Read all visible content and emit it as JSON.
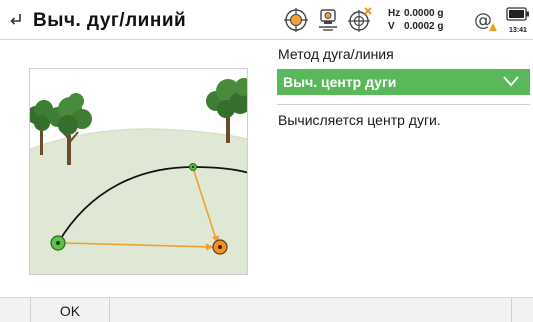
{
  "header": {
    "title": "Выч.  дуг/линий",
    "hz_label": "Hz",
    "hz_value": "0.0000 g",
    "v_label": "V",
    "v_value": "0.0002 g",
    "time": "13:41"
  },
  "form": {
    "method_label": "Метод дуга/линия",
    "method_value": "Выч. центр дуги",
    "info_text": "Вычисляется центр дуги."
  },
  "softkeys": {
    "ok_label": "OK"
  },
  "colors": {
    "accent_green": "#58b85a",
    "arrow_orange": "#f0a030",
    "warning_orange": "#f39a1e"
  },
  "icons": [
    "back-icon",
    "target-icon",
    "instrument-icon",
    "target-cross-icon",
    "at-icon",
    "battery-icon",
    "chevron-down-icon"
  ]
}
